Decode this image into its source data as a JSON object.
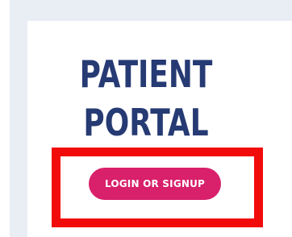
{
  "portal": {
    "title_line_1": "PATIENT",
    "title_line_2": "PORTAL"
  },
  "actions": {
    "login_signup_label": "LOGIN OR SIGNUP"
  },
  "colors": {
    "background": "#e9eef4",
    "card": "#ffffff",
    "title": "#263a73",
    "button": "#d8206b",
    "highlight": "#f20b0b"
  }
}
